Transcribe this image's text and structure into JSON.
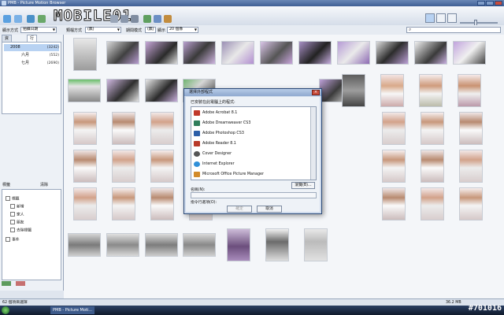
{
  "window": {
    "title": "PMB - Picture Motion Browser"
  },
  "toolbar": {
    "logo_text": "MOBILE01",
    "icons": [
      "back-icon",
      "forward-icon",
      "import-icon",
      "export-icon",
      "rotate-icon",
      "delete-icon",
      "print-icon",
      "email-icon",
      "zoom-icon",
      "settings-icon"
    ],
    "view_icons": [
      "thumbnail-view-icon",
      "detail-view-icon",
      "calendar-view-icon"
    ]
  },
  "filterbar": {
    "display_label": "顯示方式",
    "display_value": "拍攝日期",
    "filter_label": "類檔方式",
    "filter_value": "(無)",
    "period_label": "期間模式",
    "period_value": "(無)",
    "thumbs_label": "顯示",
    "thumbs_value": "20 個像"
  },
  "sidebar": {
    "tabs": [
      "資料夾",
      "行事曆"
    ],
    "tree": [
      {
        "label": "2008",
        "count": "(3242)"
      },
      {
        "label": "六月",
        "count": "(552)"
      },
      {
        "label": "七月",
        "count": "(2690)"
      }
    ],
    "keywords_title": "標籤",
    "keywords_clear": "清除",
    "keywords": [
      "標籤",
      "新增",
      "家人",
      "朋友",
      "去除標籤"
    ],
    "events_label": "事件"
  },
  "dialog": {
    "title": "選擇外部程式",
    "list_label": "已安裝在此電腦上的程式:",
    "programs": [
      "Adobe Acrobat 8.1",
      "Adobe Dreamweaver CS3",
      "Adobe Photoshop CS3",
      "Adobe Reader 8.1",
      "Cover Designer",
      "Internet Explorer",
      "Microsoft Office Picture Manager"
    ],
    "browse_label": "瀏覽(B)...",
    "name_label": "名稱(N):",
    "cmd_label": "指令行選項(O):",
    "ok_label": "確定",
    "cancel_label": "取消"
  },
  "statusbar": {
    "left": "62 個項目選擇",
    "right": "36.2 MB"
  },
  "taskbar": {
    "task_label": "PMB - Picture Moti...",
    "watermark": "#701016"
  },
  "colors": {
    "accent": "#3f5f95",
    "selection": "#b8d2f2",
    "pink_backdrop": "#c7a0d6"
  }
}
